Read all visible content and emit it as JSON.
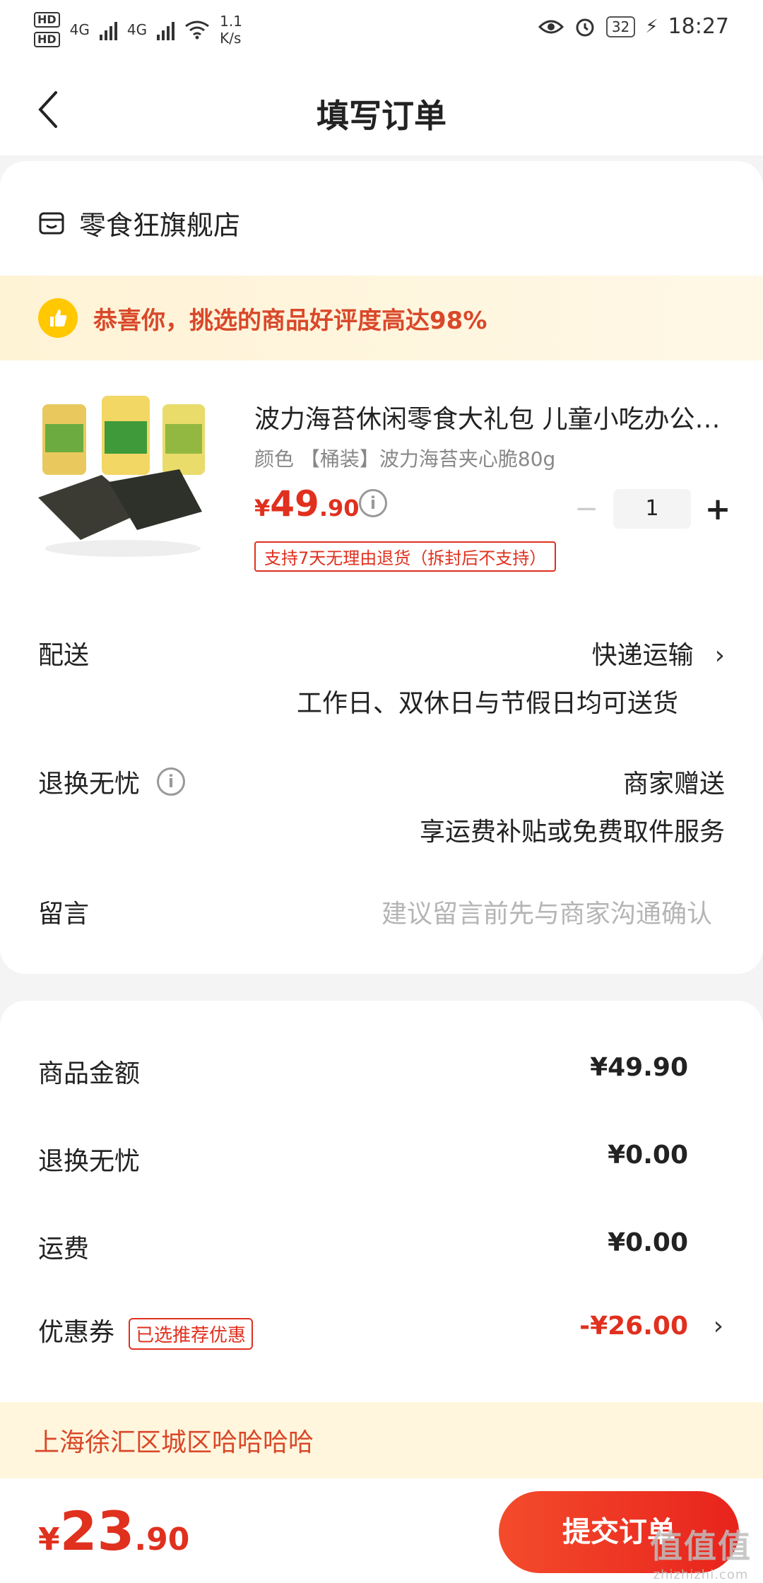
{
  "status_bar": {
    "hd1": "HD",
    "hd2": "HD",
    "net1": "4G",
    "net2": "4G",
    "speed_value": "1.1",
    "speed_unit": "K/s",
    "battery": "32",
    "time": "18:27"
  },
  "header": {
    "title": "填写订单"
  },
  "shop": {
    "name": "零食狂旗舰店"
  },
  "banner": {
    "text": "恭喜你，挑选的商品好评度高达98%"
  },
  "product": {
    "name": "波力海苔休闲零食大礼包 儿童小吃办公室零食",
    "spec": "颜色 【桶装】波力海苔夹心脆80g",
    "price_currency": "¥",
    "price_int": "49",
    "price_dec": ".90",
    "quantity": "1",
    "minus": "−",
    "plus": "+",
    "return_policy": "支持7天无理由退货（拆封后不支持）"
  },
  "delivery": {
    "label": "配送",
    "method": "快递运输",
    "note": "工作日、双休日与节假日均可送货"
  },
  "worry_free": {
    "label": "退换无忧",
    "value": "商家赠送",
    "note": "享运费补贴或免费取件服务"
  },
  "message": {
    "label": "留言",
    "placeholder": "建议留言前先与商家沟通确认"
  },
  "summary": {
    "goods_label": "商品金额",
    "goods_amount": "¥49.90",
    "worry_label": "退换无忧",
    "worry_amount": "¥0.00",
    "shipping_label": "运费",
    "shipping_amount": "¥0.00",
    "coupon_label": "优惠券",
    "coupon_badge": "已选推荐优惠",
    "coupon_amount": "-¥26.00"
  },
  "address": {
    "text": "上海徐汇区城区哈哈哈哈"
  },
  "bottom": {
    "total_currency": "¥",
    "total_int": "23",
    "total_dec": ".90",
    "submit_label": "提交订单"
  },
  "watermark": {
    "text": "值值值",
    "url": "zhizhizhi.com"
  }
}
